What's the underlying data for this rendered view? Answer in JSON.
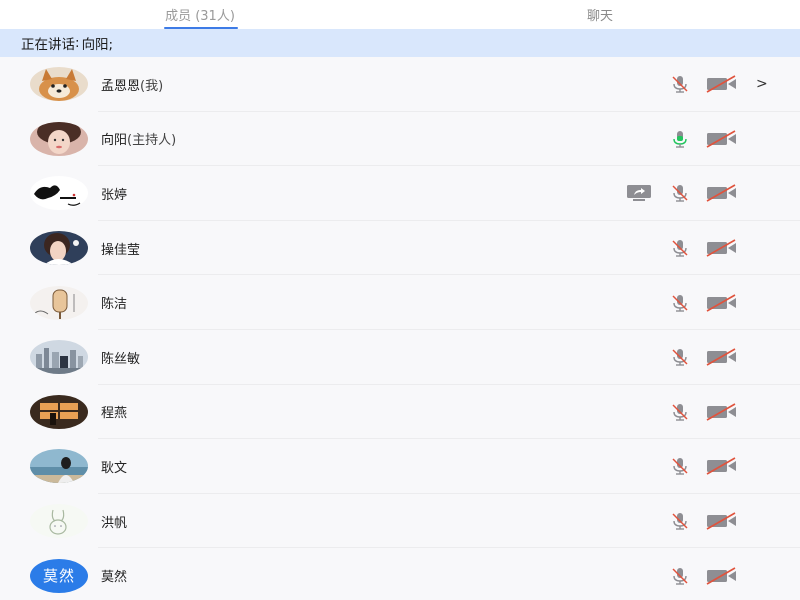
{
  "tabs": [
    {
      "label": "成员 (31人)",
      "active": true
    },
    {
      "label": "聊天",
      "active": false
    }
  ],
  "speaking": {
    "label": "正在讲话",
    "separator": ":",
    "speaker": "向阳;"
  },
  "members": [
    {
      "name": "孟恩恩",
      "role": "(我)",
      "avatar": "shiba-dog-photo",
      "mic": "muted",
      "camera": "off",
      "share": false,
      "chevron": ">"
    },
    {
      "name": "向阳",
      "role": "(主持人)",
      "avatar": "girl-selfie-photo",
      "mic": "active",
      "camera": "off",
      "share": false,
      "chevron": ""
    },
    {
      "name": "张婷",
      "role": "",
      "avatar": "cartoon-face-sketch",
      "mic": "muted",
      "camera": "off",
      "share": true,
      "chevron": ""
    },
    {
      "name": "操佳莹",
      "role": "",
      "avatar": "girl-portrait-photo",
      "mic": "muted",
      "camera": "off",
      "share": false,
      "chevron": ""
    },
    {
      "name": "陈洁",
      "role": "",
      "avatar": "ice-cream-sketch",
      "mic": "muted",
      "camera": "off",
      "share": false,
      "chevron": ""
    },
    {
      "name": "陈丝敏",
      "role": "",
      "avatar": "city-skyline-photo",
      "mic": "muted",
      "camera": "off",
      "share": false,
      "chevron": ""
    },
    {
      "name": "程燕",
      "role": "",
      "avatar": "sunset-window-photo",
      "mic": "muted",
      "camera": "off",
      "share": false,
      "chevron": ""
    },
    {
      "name": "耿文",
      "role": "",
      "avatar": "seaside-person-photo",
      "mic": "muted",
      "camera": "off",
      "share": false,
      "chevron": ""
    },
    {
      "name": "洪帆",
      "role": "",
      "avatar": "rabbit-line-drawing",
      "mic": "muted",
      "camera": "off",
      "share": false,
      "chevron": ""
    },
    {
      "name": "莫然",
      "role": "",
      "avatar": "text-avatar",
      "avatar_text": "莫然",
      "mic": "muted",
      "camera": "off",
      "share": false,
      "chevron": ""
    }
  ],
  "colors": {
    "tab_underline": "#3d7be6",
    "speaking_banner": "#d9e7fc",
    "muted_red": "#e0533d",
    "mic_active_green": "#22c55e",
    "icon_gray": "#8e8e93",
    "text_avatar_bg": "#2b7ce8"
  }
}
